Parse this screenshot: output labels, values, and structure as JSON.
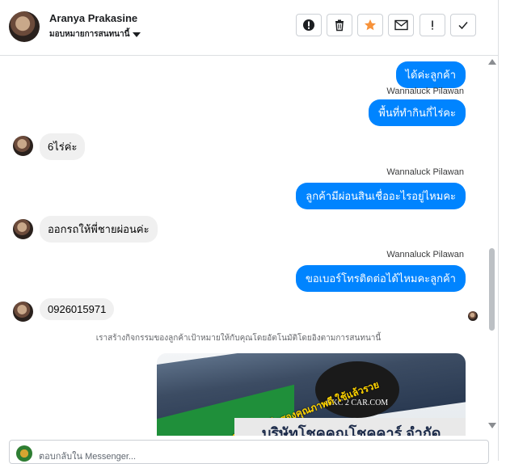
{
  "header": {
    "name": "Aranya Prakasine",
    "subtitle": "มอบหมายการสนทนานี้"
  },
  "toolbar": {
    "buttons": [
      {
        "icon": "alert-circle-icon"
      },
      {
        "icon": "trash-icon"
      },
      {
        "icon": "star-icon",
        "color": "#f7923a"
      },
      {
        "icon": "envelope-icon"
      },
      {
        "icon": "exclamation-icon"
      },
      {
        "icon": "check-icon"
      }
    ]
  },
  "messages": [
    {
      "dir": "out",
      "text": "ได้ค่ะลูกค้า"
    },
    {
      "dir": "out",
      "sender": "Wannaluck Pilawan",
      "text": "พื้นที่ทำกินกี่ไร่คะ"
    },
    {
      "dir": "in",
      "text": "6ไร่ค่ะ"
    },
    {
      "dir": "out",
      "sender": "Wannaluck Pilawan",
      "text": "ลูกค้ามีผ่อนสินเชื่ออะไรอยู่ไหมคะ"
    },
    {
      "dir": "in",
      "text": "ออกรถให้พี่ชายผ่อนค่ะ"
    },
    {
      "dir": "out",
      "sender": "Wannaluck Pilawan",
      "text": "ขอเบอร์โทรติดต่อได้ไหมคะลูกค้า"
    },
    {
      "dir": "in",
      "text": "0926015971"
    }
  ],
  "notice": "เราสร้างกิจกรรมของลูกค้าเป้าหมายให้กับคุณโดยอัตโนมัติโดยอิงตามการสนทนานี้",
  "image_card": {
    "logo_text": "CKC 2 CAR.COM",
    "tag_text": "รถกระบะมือสองคุณภาพดี ใช้แล้วรวย",
    "band_text": "บริษัทโชคคูณโชคคาร์ จำกัด"
  },
  "composer": {
    "placeholder": "ตอบกลับใน Messenger..."
  },
  "colors": {
    "outgoing_bubble": "#0084ff",
    "incoming_bubble": "#f0f0f0"
  }
}
